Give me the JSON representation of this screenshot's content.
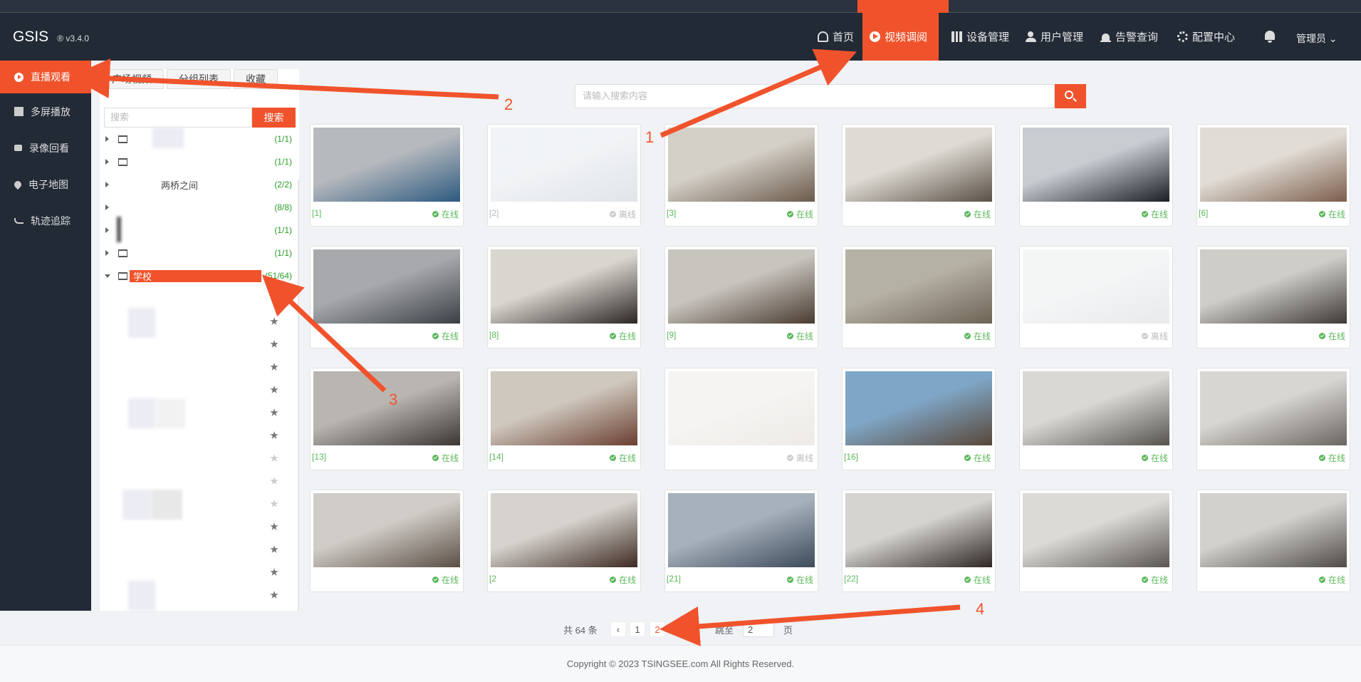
{
  "app": {
    "name": "GSIS",
    "version": "® v3.4.0"
  },
  "nav": [
    {
      "label": "首页",
      "icon": "home-icon"
    },
    {
      "label": "视频调阅",
      "icon": "play-circle-icon",
      "active": true
    },
    {
      "label": "设备管理",
      "icon": "device-icon"
    },
    {
      "label": "用户管理",
      "icon": "user-icon"
    },
    {
      "label": "告警查询",
      "icon": "alarm-icon"
    },
    {
      "label": "配置中心",
      "icon": "gear-icon"
    }
  ],
  "header": {
    "admin_label": "管理员 ⌄"
  },
  "sidebar": [
    {
      "label": "直播观看",
      "icon": "play-circle-icon",
      "active": true
    },
    {
      "label": "多屏播放",
      "icon": "grid-icon"
    },
    {
      "label": "录像回看",
      "icon": "camera-icon"
    },
    {
      "label": "电子地图",
      "icon": "map-pin-icon"
    },
    {
      "label": "轨迹追踪",
      "icon": "track-icon"
    }
  ],
  "tree_tabs": [
    "广场视频",
    "分组列表",
    "收藏"
  ],
  "tree_search": {
    "placeholder": "搜索",
    "button": "搜索"
  },
  "tree": [
    {
      "label": "",
      "count": "(1/1)"
    },
    {
      "label": "",
      "count": "(1/1)"
    },
    {
      "label": "两桥之间",
      "count": "(2/2)"
    },
    {
      "label": "",
      "count": "(8/8)"
    },
    {
      "label": "",
      "count": "(1/1)"
    },
    {
      "label": "",
      "count": "(1/1)"
    },
    {
      "label": "学校",
      "count": "(51/64)",
      "selected": true
    }
  ],
  "search": {
    "placeholder": "请输入搜索内容"
  },
  "cards": [
    {
      "title": "[1]",
      "status": "在线",
      "online": true,
      "tone": [
        "#2d5a80",
        "#b6b9bd"
      ]
    },
    {
      "title": "[2]",
      "status": "离线",
      "online": false,
      "tone": [
        "#c8d0d6",
        "#e6eaee"
      ]
    },
    {
      "title": "[3]",
      "status": "在线",
      "online": true,
      "tone": [
        "#6b5a4b",
        "#d4d0c8"
      ]
    },
    {
      "title": "",
      "status": "在线",
      "online": true,
      "tone": [
        "#5a5046",
        "#dedbd4"
      ]
    },
    {
      "title": "",
      "status": "在线",
      "online": true,
      "tone": [
        "#1a1f24",
        "#c9cdd2"
      ]
    },
    {
      "title": "[6]",
      "status": "在线",
      "online": true,
      "tone": [
        "#7c5e4c",
        "#e1ddd6"
      ]
    },
    {
      "title": "",
      "status": "在线",
      "online": true,
      "tone": [
        "#3b3f45",
        "#a7a9ac"
      ]
    },
    {
      "title": "[8]",
      "status": "在线",
      "online": true,
      "tone": [
        "#2c2623",
        "#d9d6d0"
      ]
    },
    {
      "title": "[9]",
      "status": "在线",
      "online": true,
      "tone": [
        "#4a3b30",
        "#c8c5bf"
      ]
    },
    {
      "title": "",
      "status": "在线",
      "online": true,
      "tone": [
        "#6d6355",
        "#b6b1a5"
      ]
    },
    {
      "title": "",
      "status": "离线",
      "online": false,
      "tone": [
        "#d6d9dc",
        "#eceeef"
      ]
    },
    {
      "title": "",
      "status": "在线",
      "online": true,
      "tone": [
        "#3e3a36",
        "#cfcdc8"
      ]
    },
    {
      "title": "[13]",
      "status": "在线",
      "online": true,
      "tone": [
        "#3c3633",
        "#b9b6b2"
      ]
    },
    {
      "title": "[14]",
      "status": "在线",
      "online": true,
      "tone": [
        "#6a3e30",
        "#cfc8be"
      ]
    },
    {
      "title": "",
      "status": "离线",
      "online": false,
      "tone": [
        "#dfd9d3",
        "#efece8"
      ]
    },
    {
      "title": "[16]",
      "status": "在线",
      "online": true,
      "tone": [
        "#594638",
        "#7fa6c6"
      ]
    },
    {
      "title": "",
      "status": "在线",
      "online": true,
      "tone": [
        "#56534f",
        "#dad8d4"
      ]
    },
    {
      "title": "",
      "status": "在线",
      "online": true,
      "tone": [
        "#6a6560",
        "#d8d6d2"
      ]
    },
    {
      "title": "",
      "status": "在线",
      "online": true,
      "tone": [
        "#5b4f45",
        "#d0cdc8"
      ]
    },
    {
      "title": "[2",
      "status": "在线",
      "online": true,
      "tone": [
        "#3d2a22",
        "#d6d3ce"
      ]
    },
    {
      "title": "[21]",
      "status": "在线",
      "online": true,
      "tone": [
        "#3d4a5a",
        "#a6b1bb"
      ]
    },
    {
      "title": "[22]",
      "status": "在线",
      "online": true,
      "tone": [
        "#2d2624",
        "#d6d4d0"
      ]
    },
    {
      "title": "",
      "status": "在线",
      "online": true,
      "tone": [
        "#5a5652",
        "#dcdad6"
      ]
    },
    {
      "title": "",
      "status": "在线",
      "online": true,
      "tone": [
        "#4f4b46",
        "#d3d1cd"
      ]
    }
  ],
  "pagination": {
    "total": "共 64 条",
    "prev": "‹",
    "pages": [
      "1",
      "2"
    ],
    "active": "2",
    "jump_label": "跳至",
    "jump_value": "2",
    "page_suffix": "页"
  },
  "footer": {
    "copyright": "Copyright © 2023 TSINGSEE.com All Rights Reserved."
  },
  "annotations": [
    "1",
    "2",
    "3",
    "4"
  ],
  "colors": {
    "accent": "#f0532c",
    "online": "#5cb85c",
    "header_bg": "#222a36"
  }
}
